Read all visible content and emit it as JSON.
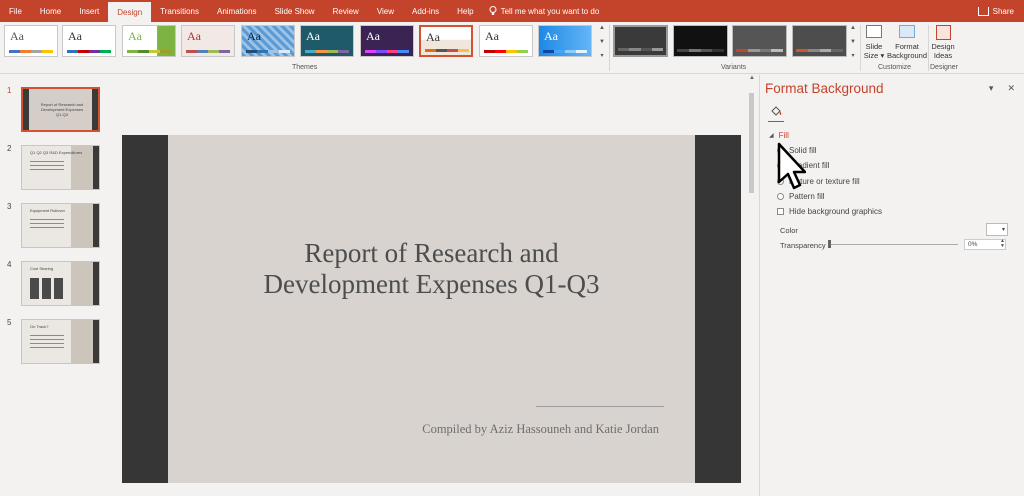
{
  "tabs": [
    "File",
    "Home",
    "Insert",
    "Design",
    "Transitions",
    "Animations",
    "Slide Show",
    "Review",
    "View",
    "Add-ins",
    "Help"
  ],
  "active_tab": "Design",
  "tell_me": "Tell me what you want to do",
  "share_label": "Share",
  "ribbon": {
    "themes_label": "Themes",
    "variants_label": "Variants",
    "customize_label": "Customize",
    "designer_label": "Designer",
    "theme_text": "Aa",
    "slide_size_line1": "Slide",
    "slide_size_line2": "Size",
    "format_bg_line1": "Format",
    "format_bg_line2": "Background",
    "design_ideas_line1": "Design",
    "design_ideas_line2": "Ideas"
  },
  "thumbnails": [
    {
      "num": "1",
      "title": "Report of Research and Development Expenses Q1-Q3"
    },
    {
      "num": "2",
      "title": "Q1 Q2 Q3 R&D Expenditures"
    },
    {
      "num": "3",
      "title": "Equipment Rollover"
    },
    {
      "num": "4",
      "title": "Cost Sharing"
    },
    {
      "num": "5",
      "title": "On Track?"
    }
  ],
  "slide": {
    "title_line1": "Report of Research and",
    "title_line2": "Development Expenses Q1-Q3",
    "subtitle": "Compiled by Aziz Hassouneh and Katie Jordan"
  },
  "pane": {
    "title": "Format Background",
    "section": "Fill",
    "options": [
      "Solid fill",
      "Gradient fill",
      "Picture or texture fill",
      "Pattern fill"
    ],
    "hide_bg": "Hide background graphics",
    "color_label": "Color",
    "transparency_label": "Transparency",
    "transparency_value": "0%"
  },
  "colors": {
    "accent": "#c4432b",
    "slide_bg": "#d8d3ce",
    "slide_panel": "#363636"
  }
}
